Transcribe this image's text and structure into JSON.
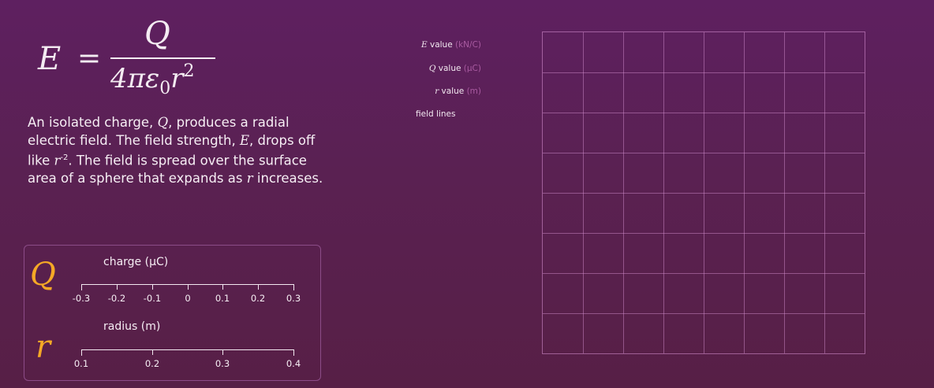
{
  "formula": {
    "lhs": "E",
    "equals": "=",
    "numerator": "Q",
    "denominator_main": "4πε",
    "denominator_sub": "0",
    "denominator_r": "r",
    "denominator_sup": "2"
  },
  "description": {
    "p1": "An isolated charge, ",
    "q": "Q",
    "p2": ", produces a radial electric field.  The field strength, ",
    "e": "E",
    "p3": ", drops off like ",
    "r": "r",
    "sup": "-2",
    "p4": ". The field is spread over the surface area of a sphere that expands as ",
    "r2": "r",
    "p5": " increases."
  },
  "labels": {
    "e_var": "E",
    "e_text": " value ",
    "e_unit": "(kN/C)",
    "q_var": "Q",
    "q_text": " value ",
    "q_unit": "(µC)",
    "r_var": "r",
    "r_text": " value ",
    "r_unit": "(m)",
    "field_lines": "field lines"
  },
  "controls": {
    "q_symbol": "Q",
    "r_symbol": "r",
    "charge": {
      "title": "charge (µC)",
      "ticks": [
        "-0.3",
        "-0.2",
        "-0.1",
        "0",
        "0.1",
        "0.2",
        "0.3"
      ]
    },
    "radius": {
      "title": "radius (m)",
      "ticks": [
        "0.1",
        "0.2",
        "0.3",
        "0.4"
      ]
    }
  },
  "grid": {
    "divisions": 8
  },
  "colors": {
    "accent_variable": "#f5a826",
    "unit_text": "#a95aa1",
    "grid_line": "#dc96d7"
  }
}
